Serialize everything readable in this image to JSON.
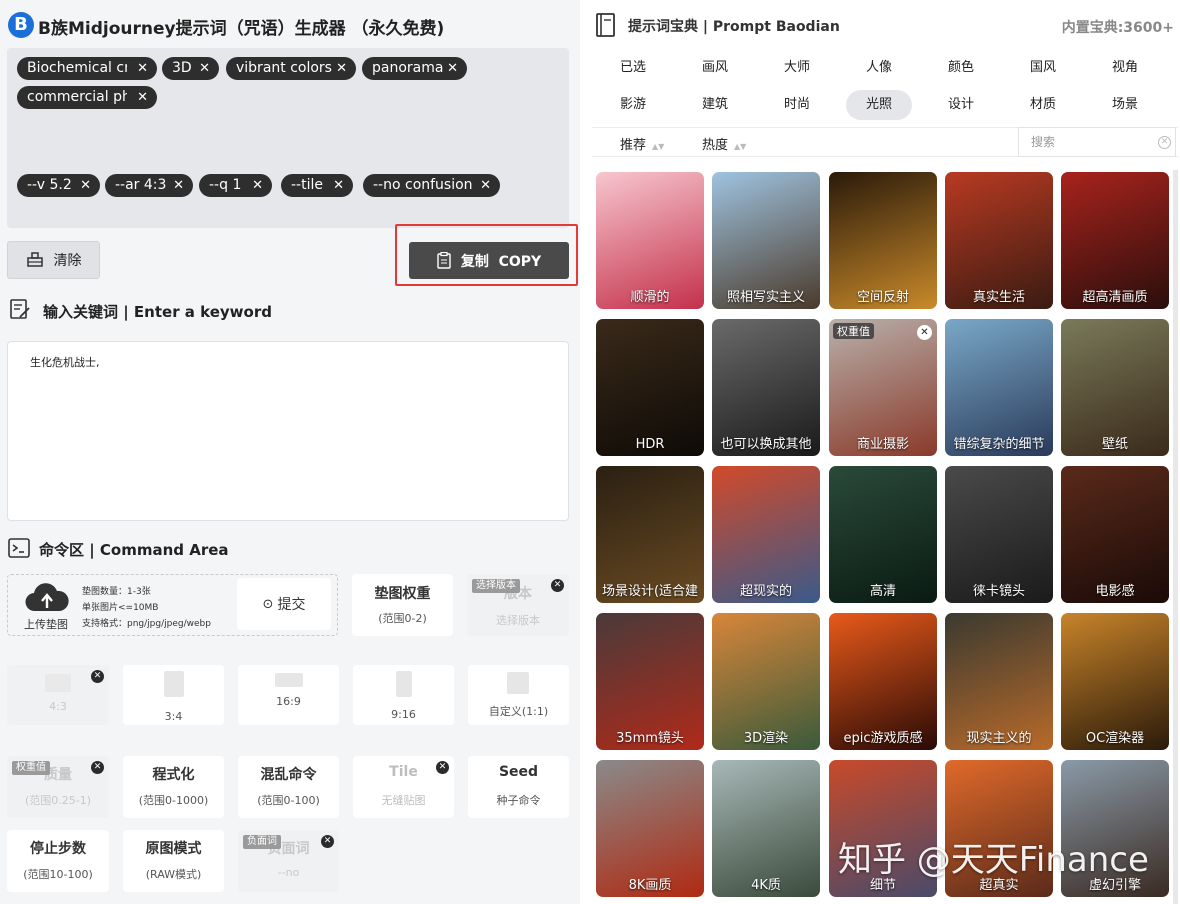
{
  "app": {
    "title": "B族Midjourney提示词（咒语）生成器 （永久免费)",
    "logo_letter": "B"
  },
  "prompt_chips": [
    {
      "label": "Biochemical cri"
    },
    {
      "label": "3D"
    },
    {
      "label": "vibrant colors"
    },
    {
      "label": "panorama"
    },
    {
      "label": "commercial pho"
    }
  ],
  "param_chips": [
    {
      "label": "--v 5.2"
    },
    {
      "label": "--ar 4:3"
    },
    {
      "label": "--q 1"
    },
    {
      "label": "--tile"
    },
    {
      "label": "--no confusion"
    }
  ],
  "actions": {
    "clear_label": "清除",
    "copy_label": "复制  COPY"
  },
  "keyword": {
    "title": "输入关键词 | Enter a keyword",
    "value": "生化危机战士,"
  },
  "command": {
    "title": "命令区 | Command Area",
    "upload_label": "上传垫图",
    "upload_info": [
      "垫图数量：1-3张",
      "单张图片<=10MB",
      "支持格式：png/jpg/jpeg/webp"
    ],
    "submit_label": "提交",
    "weight_title": "垫图权重",
    "weight_sub": "(范围0-2)",
    "version_badge": "选择版本",
    "version_title": "版本",
    "version_sub": "选择版本",
    "ratios": [
      {
        "label": "4:3"
      },
      {
        "label": "3:4"
      },
      {
        "label": "16:9"
      },
      {
        "label": "9:16"
      },
      {
        "label": "自定义(1:1)"
      }
    ],
    "quality_badge": "权重值",
    "quality_title": "质量",
    "quality_sub": "(范围0.25-1)",
    "stylize_title": "程式化",
    "stylize_sub": "(范围0-1000)",
    "chaos_title": "混乱命令",
    "chaos_sub": "(范围0-100)",
    "tile_title": "Tile",
    "tile_sub": "无缝贴图",
    "seed_title": "Seed",
    "seed_sub": "种子命令",
    "stop_title": "停止步数",
    "stop_sub": "(范围10-100)",
    "raw_title": "原图模式",
    "raw_sub": "(RAW模式)",
    "neg_badge": "负面词",
    "neg_title": "负面词",
    "neg_sub": "--no"
  },
  "baodian": {
    "title": "提示词宝典 | Prompt Baodian",
    "count": "内置宝典:3600+",
    "categories": [
      "已选",
      "画风",
      "大师",
      "人像",
      "颜色",
      "国风",
      "视角",
      "影游",
      "建筑",
      "时尚",
      "光照",
      "设计",
      "材质",
      "场景"
    ],
    "active_category": "光照",
    "sort_recommend": "推荐",
    "sort_hot": "热度",
    "search_placeholder": "搜索",
    "tiles": [
      {
        "caption": "顺滑的",
        "colors": [
          "#f7c6cf",
          "#c4314b"
        ]
      },
      {
        "caption": "照相写实主义",
        "colors": [
          "#9fc3e0",
          "#4a3a2a"
        ]
      },
      {
        "caption": "空间反射",
        "colors": [
          "#2a1a0a",
          "#c98a2a"
        ]
      },
      {
        "caption": "真实生活",
        "colors": [
          "#b83a22",
          "#3a1b12"
        ]
      },
      {
        "caption": "超高清画质",
        "colors": [
          "#a8231c",
          "#2a0e0c"
        ]
      },
      {
        "caption": "HDR",
        "colors": [
          "#3a2a1a",
          "#0e0a06"
        ]
      },
      {
        "caption": "也可以换成其他",
        "colors": [
          "#6a6a6a",
          "#1a1a1a"
        ]
      },
      {
        "caption": "商业摄影",
        "colors": [
          "#b8b0ab",
          "#8a3a2a"
        ],
        "badge": "权重值"
      },
      {
        "caption": "错综复杂的细节",
        "colors": [
          "#7aa8c8",
          "#2a3a5a"
        ]
      },
      {
        "caption": "壁纸",
        "colors": [
          "#7a7a5a",
          "#3a2a1a"
        ]
      },
      {
        "caption": "场景设计(适合建",
        "colors": [
          "#2a2012",
          "#6a4a22"
        ]
      },
      {
        "caption": "超现实的",
        "colors": [
          "#d24a2a",
          "#3a5a8a"
        ]
      },
      {
        "caption": "高清",
        "colors": [
          "#2a4a3a",
          "#0a1a12"
        ]
      },
      {
        "caption": "徕卡镜头",
        "colors": [
          "#4a4a4a",
          "#1a1a1a"
        ]
      },
      {
        "caption": "电影感",
        "colors": [
          "#5a2a1a",
          "#1a0a08"
        ]
      },
      {
        "caption": "35mm镜头",
        "colors": [
          "#4a3a3a",
          "#b02a1a"
        ]
      },
      {
        "caption": "3D渲染",
        "colors": [
          "#d8863a",
          "#3a5a3a"
        ]
      },
      {
        "caption": "epic游戏质感",
        "colors": [
          "#e85a1a",
          "#2a0a06"
        ]
      },
      {
        "caption": "现实主义的",
        "colors": [
          "#3a3a30",
          "#b86a2a"
        ]
      },
      {
        "caption": "OC渲染器",
        "colors": [
          "#c8842a",
          "#2a1a0a"
        ]
      },
      {
        "caption": "8K画质",
        "colors": [
          "#8a8a8a",
          "#b02a12"
        ]
      },
      {
        "caption": "4K质",
        "colors": [
          "#a8b8b8",
          "#3a4a3a"
        ]
      },
      {
        "caption": "细节",
        "colors": [
          "#c84a2a",
          "#4a4a6a"
        ]
      },
      {
        "caption": "超真实",
        "colors": [
          "#e06a2a",
          "#5a2a1a"
        ]
      },
      {
        "caption": "虚幻引擎",
        "colors": [
          "#8a9aa8",
          "#3a2a22"
        ]
      }
    ],
    "watermark": "知乎 @天天Finance"
  }
}
